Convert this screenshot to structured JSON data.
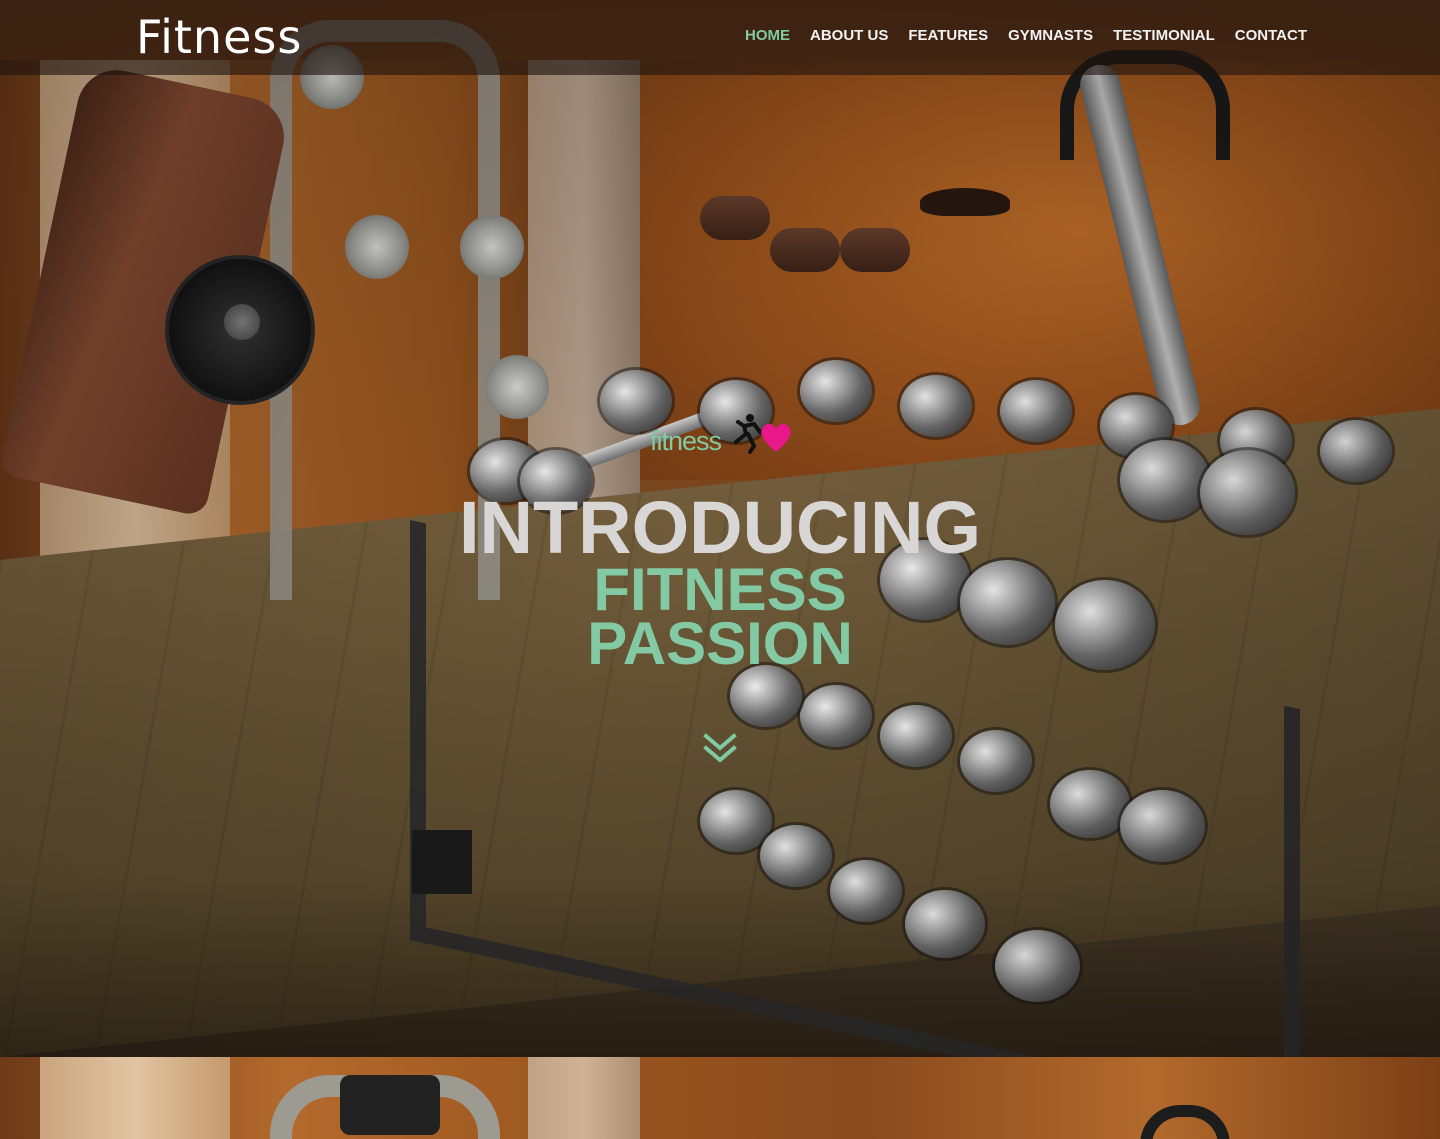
{
  "navbar": {
    "brand": "Fitness",
    "links": [
      {
        "label": "HOME",
        "active": true
      },
      {
        "label": "ABOUT US",
        "active": false
      },
      {
        "label": "FEATURES",
        "active": false
      },
      {
        "label": "GYMNASTS",
        "active": false
      },
      {
        "label": "TESTIMONIAL",
        "active": false
      },
      {
        "label": "CONTACT",
        "active": false
      }
    ]
  },
  "hero": {
    "logo_text": "fitness",
    "logo_icon": "runner-heart-icon",
    "headline_line1": "INTRODUCING",
    "headline_line2": "FITNESS",
    "headline_line3": "PASSION",
    "scroll_icon": "double-chevron-down-icon"
  },
  "colors": {
    "accent": "#7fcaa3",
    "headline_gray": "#d9d6d6",
    "logo_pink": "#e8178a",
    "nav_text": "#f2f2f2"
  }
}
